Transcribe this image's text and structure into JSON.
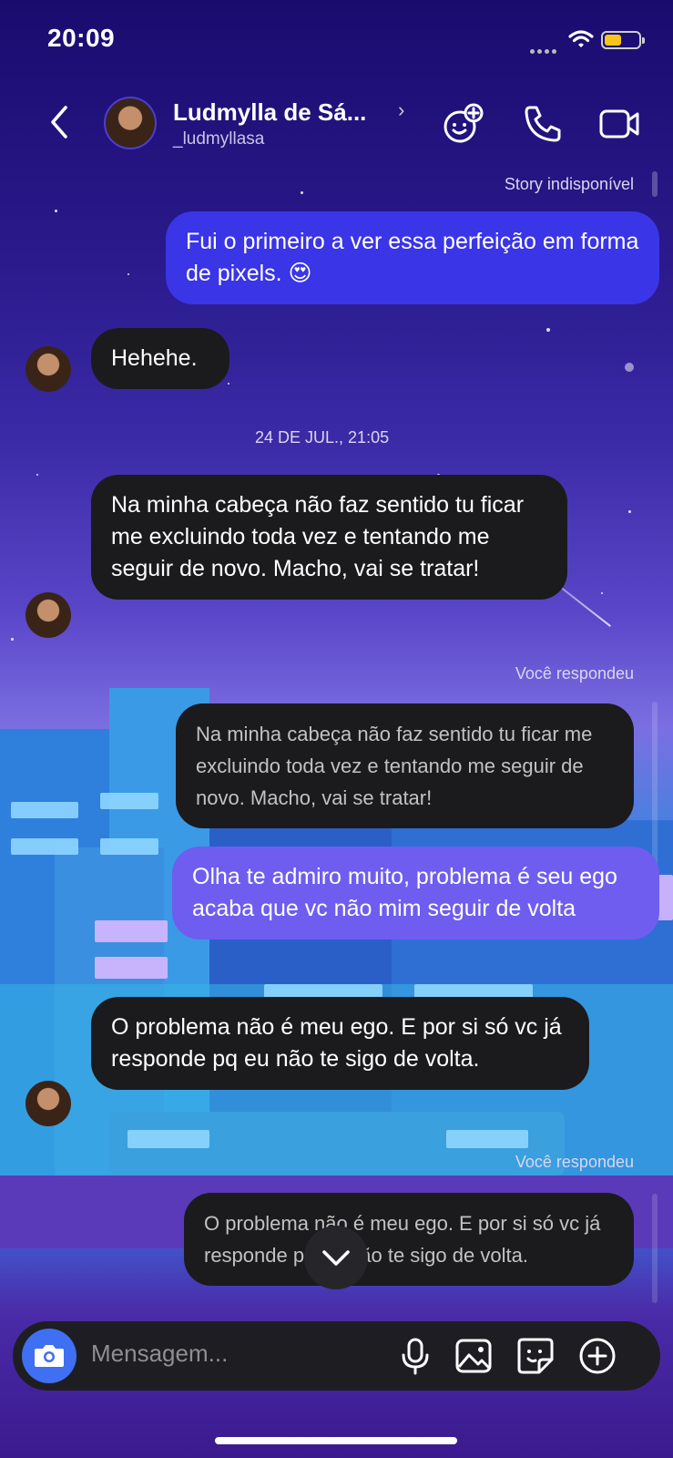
{
  "status_bar": {
    "time": "20:09"
  },
  "header": {
    "name": "Ludmylla de Sá...",
    "handle": "_ludmyllasa",
    "chevron": "›"
  },
  "messages": {
    "story_note": "Story indisponível",
    "m1": "Fui o primeiro a ver essa perfeição em forma de pixels. 😍",
    "m2": "Hehehe.",
    "timestamp": "24 DE JUL., 21:05",
    "m3": "Na minha cabeça não faz sentido tu ficar me excluindo toda vez e tentando me seguir de novo. Macho, vai se tratar!",
    "reply_note_1": "Você respondeu",
    "quote_1": "Na minha cabeça não faz sentido tu ficar me excluindo toda vez e tentando me seguir de novo. Macho, vai se tratar!",
    "m4": "Olha te admiro muito, problema é seu ego acaba que vc não mim seguir de volta",
    "m5": "O problema não é meu ego. E por si só vc já responde pq eu não te sigo de volta.",
    "reply_note_2": "Você respondeu",
    "quote_2": "O problema não é meu ego. E por si só vc já responde pq eu não te sigo de volta."
  },
  "composer": {
    "placeholder": "Mensagem..."
  },
  "icons": {
    "back": "chevron-left-icon",
    "effects": "sticker-add-icon",
    "call": "phone-icon",
    "video": "video-icon",
    "camera": "camera-icon",
    "mic": "microphone-icon",
    "gallery": "image-icon",
    "sticker": "sticker-icon",
    "add": "plus-circle-icon",
    "scroll_down": "chevron-down-icon"
  },
  "colors": {
    "outgoing_blue": "#3a35e6",
    "outgoing_violet": "#6f5df0",
    "incoming_dark": "#1b1b1d",
    "camera_button": "#3f6ff2"
  }
}
